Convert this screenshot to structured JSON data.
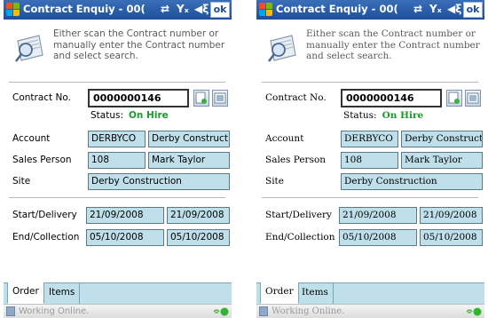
{
  "window": {
    "title": "Contract Enquiy - 00(",
    "ok_label": "ok"
  },
  "instructions": "Either scan the Contract number or manually enter the Contract number and select search.",
  "contract": {
    "label": "Contract No.",
    "value": "0000000146",
    "status_label": "Status:",
    "status_value": "On Hire"
  },
  "account": {
    "label": "Account",
    "code": "DERBYCO",
    "name": "Derby Construct"
  },
  "sales_person": {
    "label": "Sales Person",
    "code": "108",
    "name": "Mark Taylor"
  },
  "site": {
    "label": "Site",
    "value": "Derby Construction"
  },
  "start_delivery": {
    "label": "Start/Delivery",
    "date1": "21/09/2008",
    "date2": "21/09/2008"
  },
  "end_collection": {
    "label": "End/Collection",
    "date1": "05/10/2008",
    "date2": "05/10/2008"
  },
  "tabs": [
    {
      "label": "Order"
    },
    {
      "label": "Items"
    }
  ],
  "statusbar": {
    "text": "Working Online."
  },
  "colors": {
    "titlebar": "#1f4f9a",
    "field_bg": "#bfe0ea",
    "status_green": "#1a9a2a"
  }
}
